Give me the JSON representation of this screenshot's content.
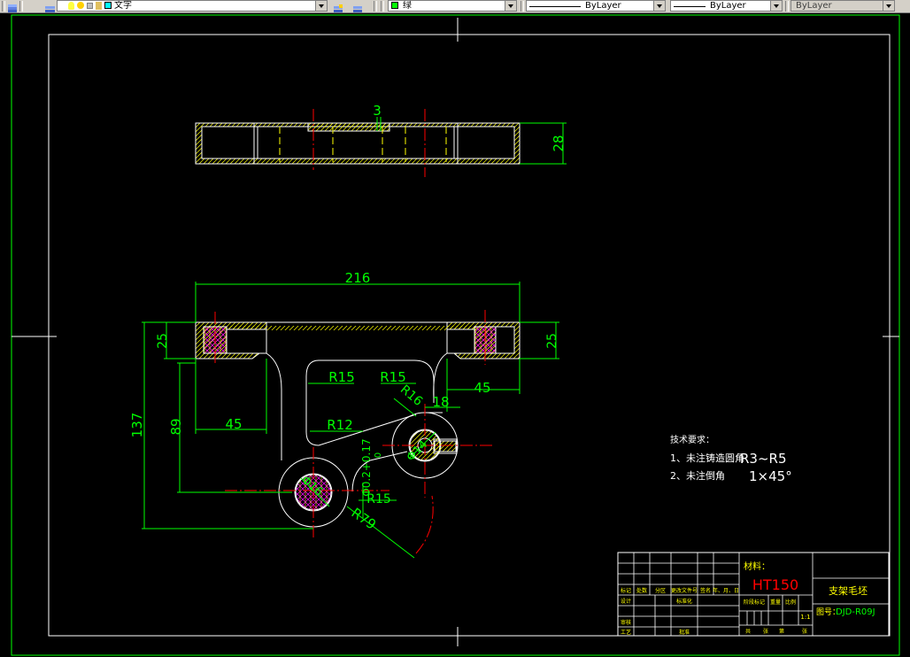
{
  "toolbar": {
    "layer_name": "文字",
    "color_name": "绿",
    "linetype": "ByLayer",
    "lineweight": "ByLayer",
    "plotstyle": "ByLayer"
  },
  "drawing": {
    "dims": {
      "d3": "3",
      "d28": "28",
      "d216": "216",
      "d25_left": "25",
      "d25_right": "25",
      "d137": "137",
      "d89": "89",
      "d45_left": "45",
      "d45_right": "45",
      "d18": "18",
      "r15_a": "R15",
      "r15_b": "R15",
      "r16": "R16",
      "r12": "R12",
      "r79": "R79",
      "r15_c": "R15",
      "d16": "Φ16",
      "d14": "Φ14",
      "tol": "Φ0.2+0.17",
      "tol_sub": "0"
    },
    "tech_req": {
      "title": "技术要求：",
      "line1_label": "1、未注铸造圆角",
      "line1_value": "R3~R5",
      "line2_label": "2、未注倒角",
      "line2_value": "1×45°"
    },
    "title_block": {
      "material_label": "材料：",
      "material": "HT150",
      "part_name": "支架毛坯",
      "drawing_no_label": "图号：",
      "drawing_no": "DJD-R09J",
      "scale": "1:1",
      "headers": [
        "标记",
        "处数",
        "分区",
        "更改文件号",
        "签名",
        "年、月、日"
      ],
      "row_design": "设计",
      "row_std": "标准化",
      "row_check": "审核",
      "row_process": "工艺",
      "row_approve": "批准",
      "stage_label": "阶段标记",
      "weight_label": "重量",
      "scale_label": "比例",
      "sheets_total": "共",
      "sheets_label": "张",
      "sheet_no": "第",
      "sheet_label": "张"
    }
  },
  "colors": {
    "green": "#00ff00",
    "white": "#ffffff",
    "red": "#ff0000",
    "yellow": "#ffff00",
    "cyan": "#00ffff",
    "magenta": "#ff00ff",
    "background": "#000000"
  }
}
